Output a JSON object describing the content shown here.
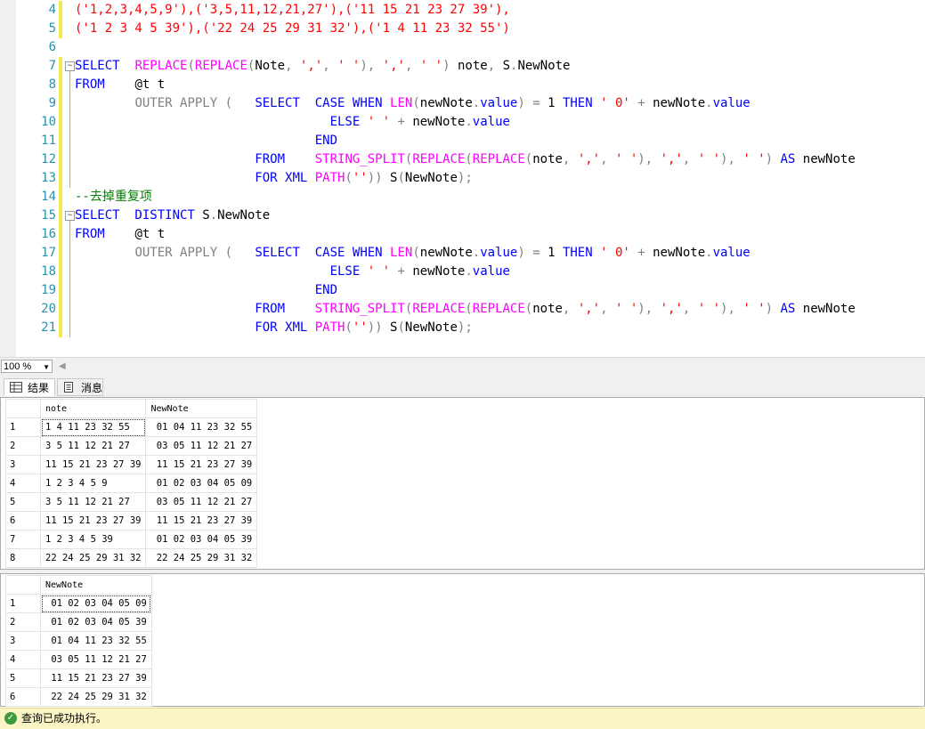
{
  "editor": {
    "line_numbers": [
      "4",
      "5",
      "6",
      "7",
      "8",
      "9",
      "10",
      "11",
      "12",
      "13",
      "14",
      "15",
      "16",
      "17",
      "18",
      "19",
      "20",
      "21"
    ],
    "lines": [
      [
        [
          "s",
          "('1,2,3,4,5,9'),('3,5,11,12,21,27'),('11 15 21 23 27 39'),"
        ]
      ],
      [
        [
          "s",
          "('1 2 3 4 5 39'),('22 24 25 29 31 32'),('1 4 11 23 32 55')"
        ]
      ],
      [],
      [
        [
          "k",
          "SELECT  "
        ],
        [
          "f",
          "REPLACE"
        ],
        [
          "g",
          "("
        ],
        [
          "f",
          "REPLACE"
        ],
        [
          "g",
          "("
        ],
        [
          "t",
          "Note"
        ],
        [
          "g",
          ", "
        ],
        [
          "s",
          "','"
        ],
        [
          "g",
          ", "
        ],
        [
          "s",
          "' '"
        ],
        [
          "g",
          "), "
        ],
        [
          "s",
          "','"
        ],
        [
          "g",
          ", "
        ],
        [
          "s",
          "' '"
        ],
        [
          "g",
          ")"
        ],
        [
          "t",
          " note"
        ],
        [
          "g",
          ", "
        ],
        [
          "t",
          "S"
        ],
        [
          "g",
          "."
        ],
        [
          "t",
          "NewNote"
        ]
      ],
      [
        [
          "k",
          "FROM    "
        ],
        [
          "t",
          "@t t"
        ]
      ],
      [
        [
          "t",
          "        "
        ],
        [
          "o",
          "OUTER APPLY ("
        ],
        [
          "t",
          "   "
        ],
        [
          "k",
          "SELECT  CASE WHEN "
        ],
        [
          "f",
          "LEN"
        ],
        [
          "g",
          "("
        ],
        [
          "t",
          "newNote"
        ],
        [
          "g",
          "."
        ],
        [
          "k",
          "value"
        ],
        [
          "g",
          ") = "
        ],
        [
          "t",
          "1 "
        ],
        [
          "k",
          "THEN "
        ],
        [
          "s",
          "' 0'"
        ],
        [
          "g",
          " + "
        ],
        [
          "t",
          "newNote"
        ],
        [
          "g",
          "."
        ],
        [
          "k",
          "value"
        ]
      ],
      [
        [
          "t",
          "                                  "
        ],
        [
          "k",
          "ELSE "
        ],
        [
          "s",
          "' '"
        ],
        [
          "g",
          " + "
        ],
        [
          "t",
          "newNote"
        ],
        [
          "g",
          "."
        ],
        [
          "k",
          "value"
        ]
      ],
      [
        [
          "t",
          "                                "
        ],
        [
          "k",
          "END"
        ]
      ],
      [
        [
          "t",
          "                        "
        ],
        [
          "k",
          "FROM    "
        ],
        [
          "f",
          "STRING_SPLIT"
        ],
        [
          "g",
          "("
        ],
        [
          "f",
          "REPLACE"
        ],
        [
          "g",
          "("
        ],
        [
          "f",
          "REPLACE"
        ],
        [
          "g",
          "("
        ],
        [
          "t",
          "note"
        ],
        [
          "g",
          ", "
        ],
        [
          "s",
          "','"
        ],
        [
          "g",
          ", "
        ],
        [
          "s",
          "' '"
        ],
        [
          "g",
          "), "
        ],
        [
          "s",
          "','"
        ],
        [
          "g",
          ", "
        ],
        [
          "s",
          "' '"
        ],
        [
          "g",
          "), "
        ],
        [
          "s",
          "' '"
        ],
        [
          "g",
          ") "
        ],
        [
          "k",
          "AS "
        ],
        [
          "t",
          "newNote"
        ]
      ],
      [
        [
          "t",
          "                        "
        ],
        [
          "k",
          "FOR XML "
        ],
        [
          "f",
          "PATH"
        ],
        [
          "g",
          "("
        ],
        [
          "s",
          "''"
        ],
        [
          "g",
          "))"
        ],
        [
          "t",
          " S"
        ],
        [
          "g",
          "("
        ],
        [
          "t",
          "NewNote"
        ],
        [
          "g",
          ");"
        ]
      ],
      [
        [
          "c",
          "--去掉重复项"
        ]
      ],
      [
        [
          "k",
          "SELECT  DISTINCT "
        ],
        [
          "t",
          "S"
        ],
        [
          "g",
          "."
        ],
        [
          "t",
          "NewNote"
        ]
      ],
      [
        [
          "k",
          "FROM    "
        ],
        [
          "t",
          "@t t"
        ]
      ],
      [
        [
          "t",
          "        "
        ],
        [
          "o",
          "OUTER APPLY ("
        ],
        [
          "t",
          "   "
        ],
        [
          "k",
          "SELECT  CASE WHEN "
        ],
        [
          "f",
          "LEN"
        ],
        [
          "g",
          "("
        ],
        [
          "t",
          "newNote"
        ],
        [
          "g",
          "."
        ],
        [
          "k",
          "value"
        ],
        [
          "g",
          ") = "
        ],
        [
          "t",
          "1 "
        ],
        [
          "k",
          "THEN "
        ],
        [
          "s",
          "' 0'"
        ],
        [
          "g",
          " + "
        ],
        [
          "t",
          "newNote"
        ],
        [
          "g",
          "."
        ],
        [
          "k",
          "value"
        ]
      ],
      [
        [
          "t",
          "                                  "
        ],
        [
          "k",
          "ELSE "
        ],
        [
          "s",
          "' '"
        ],
        [
          "g",
          " + "
        ],
        [
          "t",
          "newNote"
        ],
        [
          "g",
          "."
        ],
        [
          "k",
          "value"
        ]
      ],
      [
        [
          "t",
          "                                "
        ],
        [
          "k",
          "END"
        ]
      ],
      [
        [
          "t",
          "                        "
        ],
        [
          "k",
          "FROM    "
        ],
        [
          "f",
          "STRING_SPLIT"
        ],
        [
          "g",
          "("
        ],
        [
          "f",
          "REPLACE"
        ],
        [
          "g",
          "("
        ],
        [
          "f",
          "REPLACE"
        ],
        [
          "g",
          "("
        ],
        [
          "t",
          "note"
        ],
        [
          "g",
          ", "
        ],
        [
          "s",
          "','"
        ],
        [
          "g",
          ", "
        ],
        [
          "s",
          "' '"
        ],
        [
          "g",
          "), "
        ],
        [
          "s",
          "','"
        ],
        [
          "g",
          ", "
        ],
        [
          "s",
          "' '"
        ],
        [
          "g",
          "), "
        ],
        [
          "s",
          "' '"
        ],
        [
          "g",
          ") "
        ],
        [
          "k",
          "AS "
        ],
        [
          "t",
          "newNote"
        ]
      ],
      [
        [
          "t",
          "                        "
        ],
        [
          "k",
          "FOR XML "
        ],
        [
          "f",
          "PATH"
        ],
        [
          "g",
          "("
        ],
        [
          "s",
          "''"
        ],
        [
          "g",
          "))"
        ],
        [
          "t",
          " S"
        ],
        [
          "g",
          "("
        ],
        [
          "t",
          "NewNote"
        ],
        [
          "g",
          ");"
        ]
      ]
    ]
  },
  "zoom": {
    "value": "100 %"
  },
  "tabs": {
    "results": "结果",
    "messages": "消息"
  },
  "grid1": {
    "headers": [
      "note",
      "NewNote"
    ],
    "rows": [
      [
        "1",
        "1 4 11 23 32 55",
        " 01 04 11 23 32 55"
      ],
      [
        "2",
        "3 5 11 12 21 27",
        " 03 05 11 12 21 27"
      ],
      [
        "3",
        "11 15 21 23 27 39",
        " 11 15 21 23 27 39"
      ],
      [
        "4",
        "1 2 3 4 5 9",
        " 01 02 03 04 05 09"
      ],
      [
        "5",
        "3 5 11 12 21 27",
        " 03 05 11 12 21 27"
      ],
      [
        "6",
        "11 15 21 23 27 39",
        " 11 15 21 23 27 39"
      ],
      [
        "7",
        "1 2 3 4 5 39",
        " 01 02 03 04 05 39"
      ],
      [
        "8",
        "22 24 25 29 31 32",
        " 22 24 25 29 31 32"
      ]
    ]
  },
  "grid2": {
    "headers": [
      "NewNote"
    ],
    "rows": [
      [
        "1",
        " 01 02 03 04 05 09"
      ],
      [
        "2",
        " 01 02 03 04 05 39"
      ],
      [
        "3",
        " 01 04 11 23 32 55"
      ],
      [
        "4",
        " 03 05 11 12 21 27"
      ],
      [
        "5",
        " 11 15 21 23 27 39"
      ],
      [
        "6",
        " 22 24 25 29 31 32"
      ]
    ]
  },
  "status": {
    "text": "查询已成功执行。"
  },
  "colors": {
    "keyword": "#0000ff",
    "function": "#ff00ff",
    "string": "#ff0000",
    "comment": "#008000",
    "line_number": "#2b91af",
    "status_bg": "#fbf5c6"
  }
}
